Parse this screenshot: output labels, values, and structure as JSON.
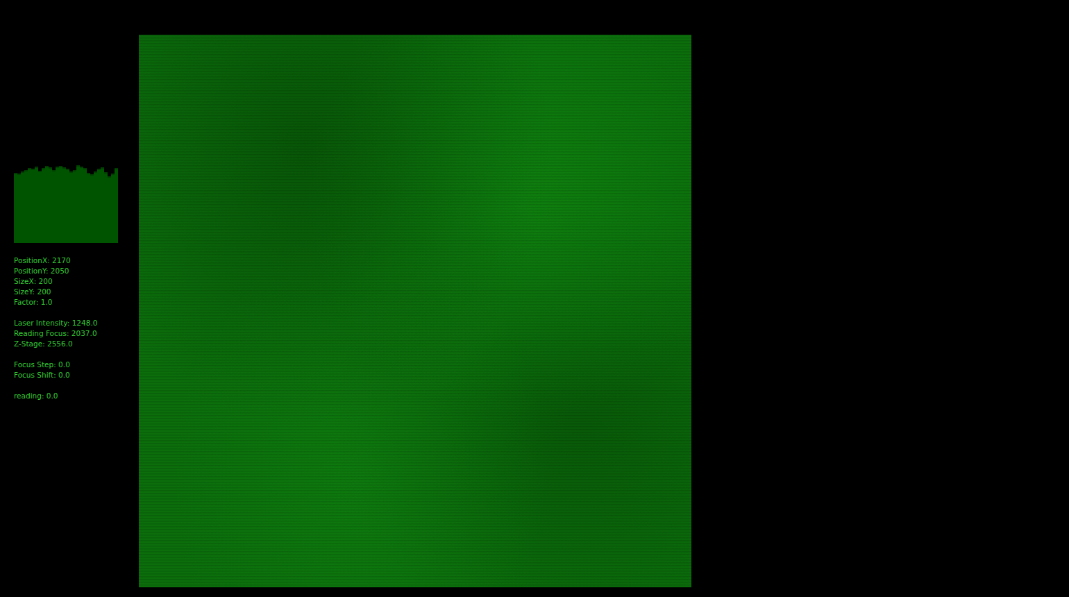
{
  "histogram": {
    "max": 100,
    "values": [
      86,
      85,
      88,
      90,
      92,
      91,
      94,
      89,
      92,
      95,
      93,
      90,
      94,
      95,
      93,
      91,
      88,
      90,
      96,
      94,
      92,
      86,
      84,
      88,
      91,
      93,
      87,
      82,
      85,
      92
    ]
  },
  "readout_groups": [
    {
      "lines": [
        "PositionX: 2170",
        "PositionY: 2050",
        "SizeX: 200",
        "SizeY: 200",
        "Factor: 1.0"
      ]
    },
    {
      "lines": [
        "Laser Intensity: 1248.0",
        "Reading Focus: 2037.0",
        "Z-Stage: 2556.0"
      ]
    },
    {
      "lines": [
        "Focus Step: 0.0",
        "Focus Shift: 0.0"
      ]
    },
    {
      "lines": [
        "reading: 0.0"
      ]
    }
  ]
}
